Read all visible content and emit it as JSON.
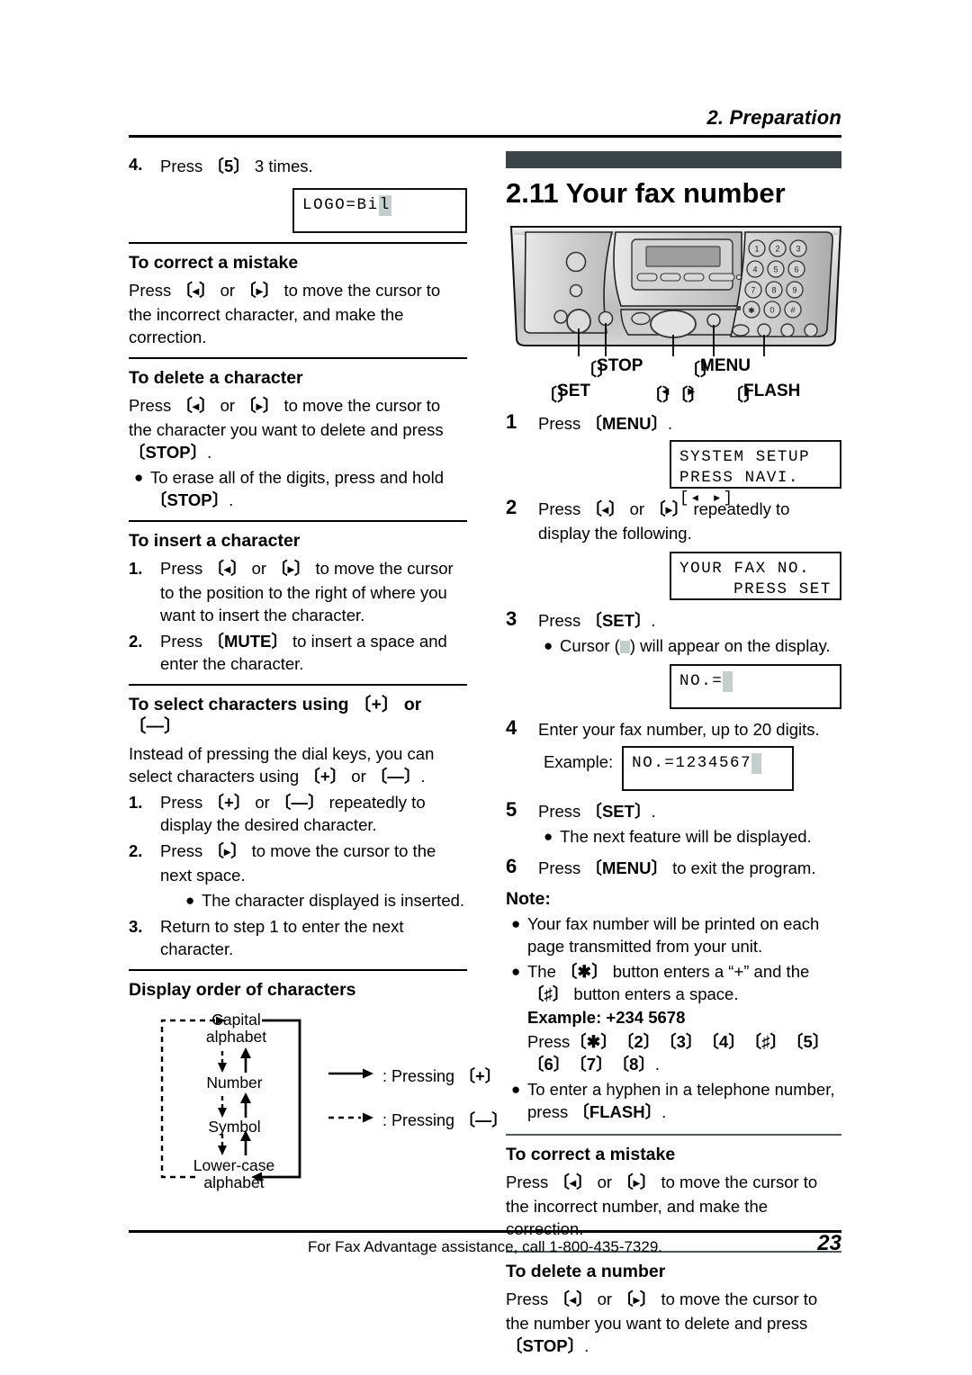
{
  "header": {
    "chapter_title": "2. Preparation"
  },
  "footer": {
    "assistance": "For Fax Advantage assistance, call 1-800-435-7329.",
    "page_number": "23"
  },
  "left_column": {
    "step4": {
      "number": "4.",
      "text_before": "Press",
      "key": "5",
      "text_after": "3 times."
    },
    "lcd_logo": {
      "line1_pre": "LOGO=Bi",
      "line1_cursor_char": "l"
    },
    "correct_mistake": {
      "heading": "To correct a mistake",
      "body_1": "Press",
      "body_2": "or",
      "body_3": "to move the cursor to the incorrect character, and make the correction."
    },
    "delete_character": {
      "heading": "To delete a character",
      "body_1": "Press",
      "body_2": "or",
      "body_3": "to move the cursor to the",
      "body_4": "character you want to delete and press",
      "key_stop": "STOP",
      "body_5": ".",
      "bullet_1a": "To erase all of the digits, press and hold",
      "bullet_1b": "STOP",
      "bullet_1c": "."
    },
    "insert_character": {
      "heading": "To insert a character",
      "item1_num": "1.",
      "item1_a": "Press",
      "item1_b": "or",
      "item1_c": "to move the cursor to the position to the right of where you want to insert the character.",
      "item2_num": "2.",
      "item2_a": "Press",
      "item2_key": "MUTE",
      "item2_b": "to insert a space and enter the character."
    },
    "select_characters": {
      "heading_a": "To select characters using",
      "heading_key_plus": "+",
      "heading_or": "or",
      "heading_key_minus": "—",
      "intro_a": "Instead of pressing the dial keys, you can select characters using",
      "intro_or": "or",
      "intro_end": ".",
      "item1_num": "1.",
      "item1_a": "Press",
      "item1_or": "or",
      "item1_b": "repeatedly to display the desired character.",
      "item2_num": "2.",
      "item2_a": "Press",
      "item2_b": "to move the cursor to the next space.",
      "item2_bullet": "The character displayed is inserted.",
      "item3_num": "3.",
      "item3_a": "Return to step 1 to enter the next character."
    },
    "display_order": {
      "heading": "Display order of characters",
      "node_1a": "Capital",
      "node_1b": "alphabet",
      "node_2": "Number",
      "node_3": "Symbol",
      "node_4a": "Lower-case",
      "node_4b": "alphabet",
      "legend_solid": ": Pressing",
      "legend_solid_key": "+",
      "legend_dashed": ": Pressing",
      "legend_dashed_key": "—"
    }
  },
  "right_column": {
    "section_number_title": "2.11 Your fax number",
    "fax_unit": {
      "keypad": [
        "1",
        "2",
        "3",
        "4",
        "5",
        "6",
        "7",
        "8",
        "9",
        "✱",
        "0",
        "#"
      ],
      "callout_stop": "STOP",
      "callout_menu": "MENU",
      "callout_set": "SET",
      "callout_nav_left": "◂",
      "callout_nav_right": "▸",
      "callout_flash": "FLASH"
    },
    "step1": {
      "number": "1",
      "text": "Press",
      "key": "MENU",
      "tail": "."
    },
    "lcd_system_setup": {
      "line1": "SYSTEM SETUP",
      "line2_pre": "PRESS NAVI.[",
      "line2_left": "◂",
      "line2_right": "▸",
      "line2_post": "]"
    },
    "step2": {
      "number": "2",
      "text_a": "Press",
      "text_or": "or",
      "text_b": "repeatedly to display the following."
    },
    "lcd_your_fax_no": {
      "line1": "YOUR FAX NO.",
      "line2": "PRESS SET"
    },
    "step3": {
      "number": "3",
      "text": "Press",
      "key": "SET",
      "tail": ".",
      "bullet_a": "Cursor (",
      "bullet_b": ") will appear on the display."
    },
    "lcd_no_empty": {
      "line1": "NO.="
    },
    "step4": {
      "number": "4",
      "text": "Enter your fax number, up to 20 digits.",
      "example_label": "Example:"
    },
    "lcd_no_example": {
      "line1": "NO.=1234567"
    },
    "step5": {
      "number": "5",
      "text": "Press",
      "key": "SET",
      "tail": ".",
      "bullet": "The next feature will be displayed."
    },
    "step6": {
      "number": "6",
      "text_a": "Press",
      "key": "MENU",
      "text_b": "to exit the program."
    },
    "note": {
      "heading": "Note:",
      "bullet1": "Your fax number will be printed on each page transmitted from your unit.",
      "bullet2_a": "The",
      "bullet2_key1": "✱",
      "bullet2_b": "button enters a “+” and the",
      "bullet2_key2": "♯",
      "bullet2_c": "button enters a space.",
      "example_label": "Example: +234 5678",
      "example_press": "Press",
      "example_keys": [
        "✱",
        "2",
        "3",
        "4",
        "♯",
        "5",
        "6",
        "7",
        "8"
      ],
      "example_tail": ".",
      "bullet3_a": "To enter a hyphen in a telephone number, press",
      "bullet3_key": "FLASH",
      "bullet3_b": "."
    },
    "correct_mistake": {
      "heading": "To correct a mistake",
      "body_a": "Press",
      "body_or": "or",
      "body_b": "to move the cursor to the incorrect number, and make the correction."
    },
    "delete_number": {
      "heading": "To delete a number",
      "body_a": "Press",
      "body_or": "or",
      "body_b": "to move the cursor to the",
      "body_c": "number you want to delete and press",
      "key_stop": "STOP",
      "body_d": "."
    }
  },
  "colors": {
    "accent_bar": "#3a4449",
    "cursor_highlight": "#c3cfce",
    "rule": "#000000",
    "thin_rule": "#4a5a5e"
  }
}
